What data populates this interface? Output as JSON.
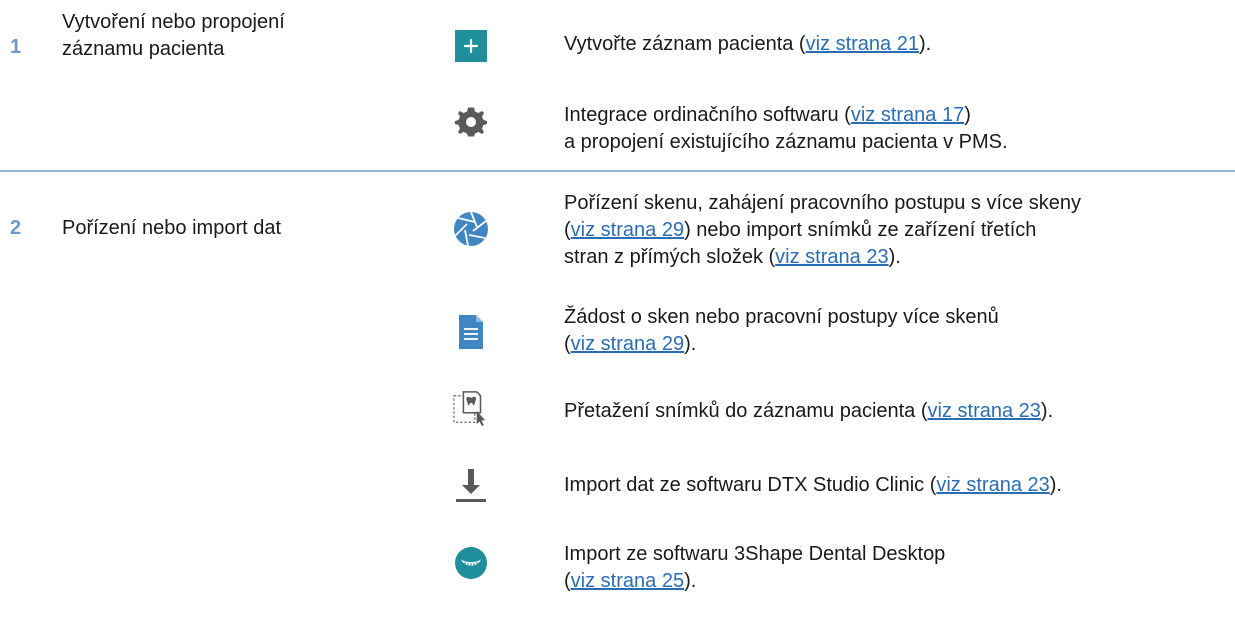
{
  "sections": [
    {
      "number": "1",
      "title_lines": [
        "Vytvoření nebo propojení",
        "záznamu pacienta"
      ]
    },
    {
      "number": "2",
      "title_lines": [
        "Pořízení nebo import dat"
      ]
    }
  ],
  "rows": [
    {
      "icon": "plus-icon",
      "text": [
        "Vytvořte záznam pacienta (",
        "viz strana 21",
        ")."
      ]
    },
    {
      "icon": "gear-icon",
      "text": [
        "Integrace ordinačního softwaru (",
        "viz strana 17",
        ")",
        "a propojení existujícího záznamu pacienta v PMS."
      ]
    },
    {
      "icon": "aperture-icon",
      "text": [
        "Pořízení skenu, zahájení pracovního postupu s více skeny",
        "(",
        "viz strana 29",
        ") nebo import snímků ze zařízení třetích",
        "stran z přímých složek (",
        "viz strana 23",
        ")."
      ]
    },
    {
      "icon": "document-icon",
      "text": [
        "Žádost o sken nebo pracovní postupy více skenů",
        "(",
        "viz strana 29",
        ")."
      ]
    },
    {
      "icon": "drag-drop-icon",
      "text": [
        "Přetažení snímků do záznamu pacienta (",
        "viz strana 23",
        ")."
      ]
    },
    {
      "icon": "download-icon",
      "text": [
        "Import dat ze softwaru DTX Studio Clinic (",
        "viz strana 23",
        ")."
      ]
    },
    {
      "icon": "dental-arch-icon",
      "text": [
        "Import ze softwaru 3Shape Dental Desktop",
        "(",
        "viz strana 25",
        ")."
      ]
    }
  ],
  "colors": {
    "teal": "#1f8f9c",
    "gray_icon": "#5a5a5a",
    "blue_icon": "#3f86c2",
    "number_blue": "#6f98c4",
    "link": "#2a6db5",
    "divider": "#9fb8d6"
  }
}
